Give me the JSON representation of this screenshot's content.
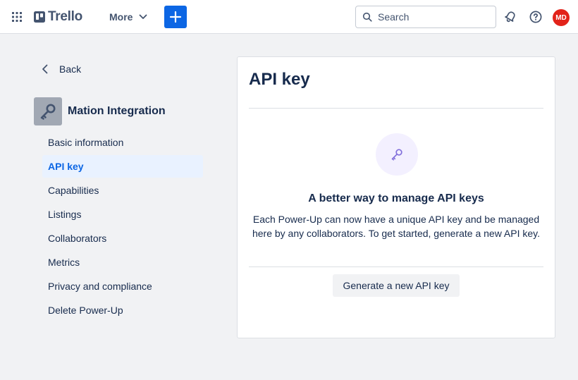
{
  "header": {
    "logo_text": "Trello",
    "more_label": "More",
    "search_placeholder": "Search",
    "avatar_initials": "MD",
    "accent_color": "#0c66e4",
    "avatar_color": "#e2231a"
  },
  "sidebar": {
    "back_label": "Back",
    "powerup_name": "Mation Integration",
    "items": [
      {
        "label": "Basic information",
        "active": false
      },
      {
        "label": "API key",
        "active": true
      },
      {
        "label": "Capabilities",
        "active": false
      },
      {
        "label": "Listings",
        "active": false
      },
      {
        "label": "Collaborators",
        "active": false
      },
      {
        "label": "Metrics",
        "active": false
      },
      {
        "label": "Privacy and compliance",
        "active": false
      },
      {
        "label": "Delete Power-Up",
        "active": false
      }
    ]
  },
  "main": {
    "title": "API key",
    "empty_heading": "A better way to manage API keys",
    "empty_description": "Each Power-Up can now have a unique API key and be managed here by any collaborators. To get started, generate a new API key.",
    "generate_button_label": "Generate a new API key"
  },
  "icons": {
    "apps": "grid-icon",
    "create": "plus-icon",
    "search": "search-icon",
    "notifications": "bell-icon",
    "help": "help-icon",
    "back": "chevron-left-icon",
    "key": "key-icon"
  }
}
